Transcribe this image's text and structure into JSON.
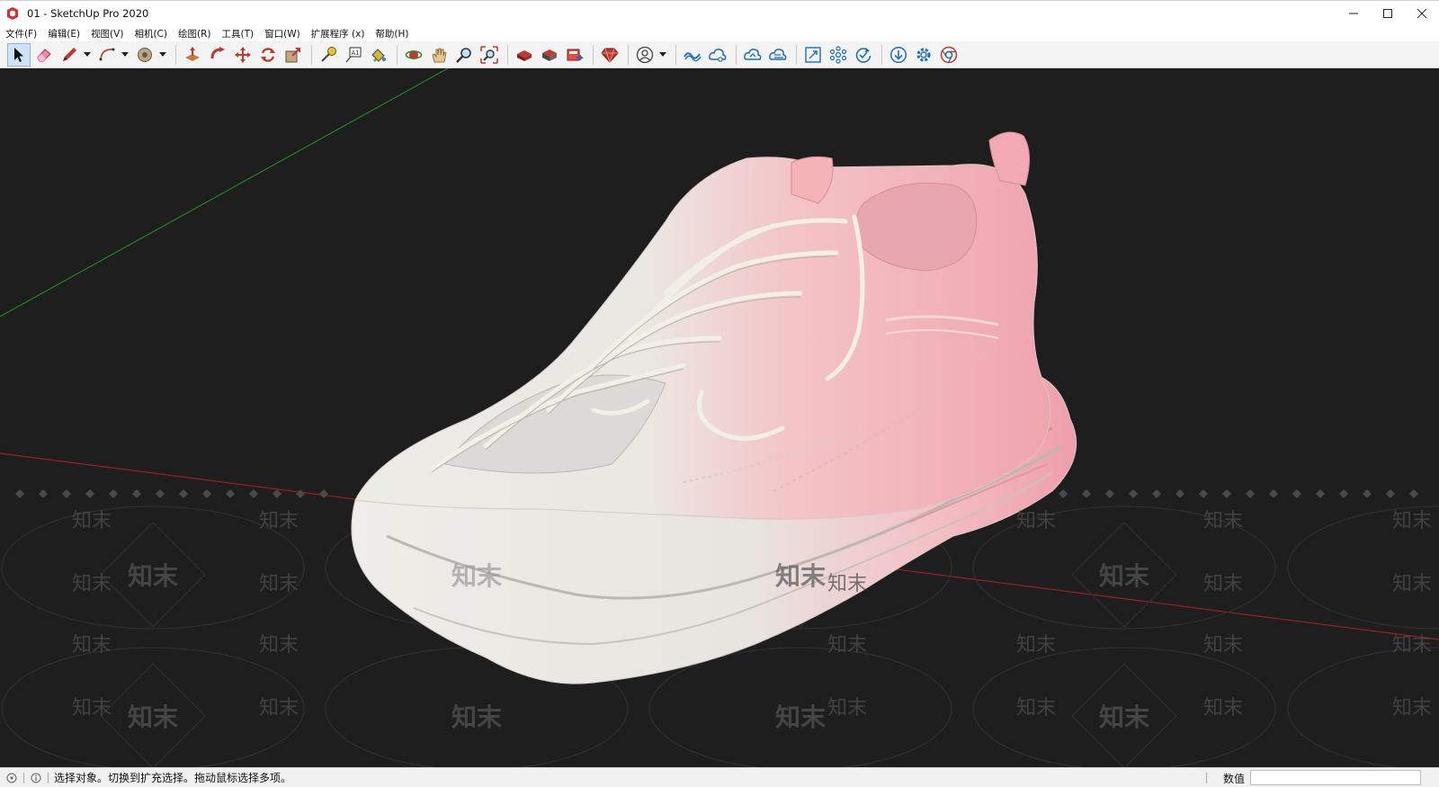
{
  "window": {
    "title": "01 - SketchUp Pro 2020",
    "app_icon": "sketchup-logo-icon",
    "controls": [
      "minimize-icon",
      "maximize-icon",
      "close-icon"
    ]
  },
  "menu": {
    "items": [
      "文件(F)",
      "编辑(E)",
      "视图(V)",
      "相机(C)",
      "绘图(R)",
      "工具(T)",
      "窗口(W)",
      "扩展程序 (x)",
      "帮助(H)"
    ]
  },
  "toolbar": {
    "groups": [
      [
        "select-icon",
        "eraser-icon",
        "pencil-icon",
        "arc-icon",
        "tape-circle-icon"
      ],
      [
        "push-pull-icon",
        "follow-me-icon",
        "move-icon",
        "rotate-icon",
        "scale-icon"
      ],
      [
        "tape-measure-icon",
        "text-icon",
        "paint-bucket-icon"
      ],
      [
        "orbit-icon",
        "pan-icon",
        "zoom-icon",
        "zoom-extents-icon"
      ],
      [
        "warehouse-icon",
        "extension-warehouse-icon",
        "layout-icon"
      ],
      [
        "ruby-console-icon"
      ],
      [
        "account-icon"
      ],
      [
        "trimble-connect-icon",
        "cloud-share-icon"
      ],
      [
        "cloud-sync-icon",
        "cloud-upload-icon"
      ],
      [
        "expand-icon",
        "network-icon",
        "refresh-check-icon"
      ],
      [
        "download-icon",
        "settings-icon",
        "chrome-icon"
      ]
    ],
    "active_tool": "select-icon"
  },
  "viewport": {
    "background": "#1e1e1e",
    "axis_colors": {
      "green": "#1f9a1f",
      "red": "#b02020"
    },
    "watermark_text": "知末",
    "model": "pink and white sneaker 3D scan"
  },
  "status": {
    "hint": "选择对象。切换到扩充选择。拖动鼠标选择多项。",
    "measurements_label": "数值",
    "measurements_value": ""
  }
}
